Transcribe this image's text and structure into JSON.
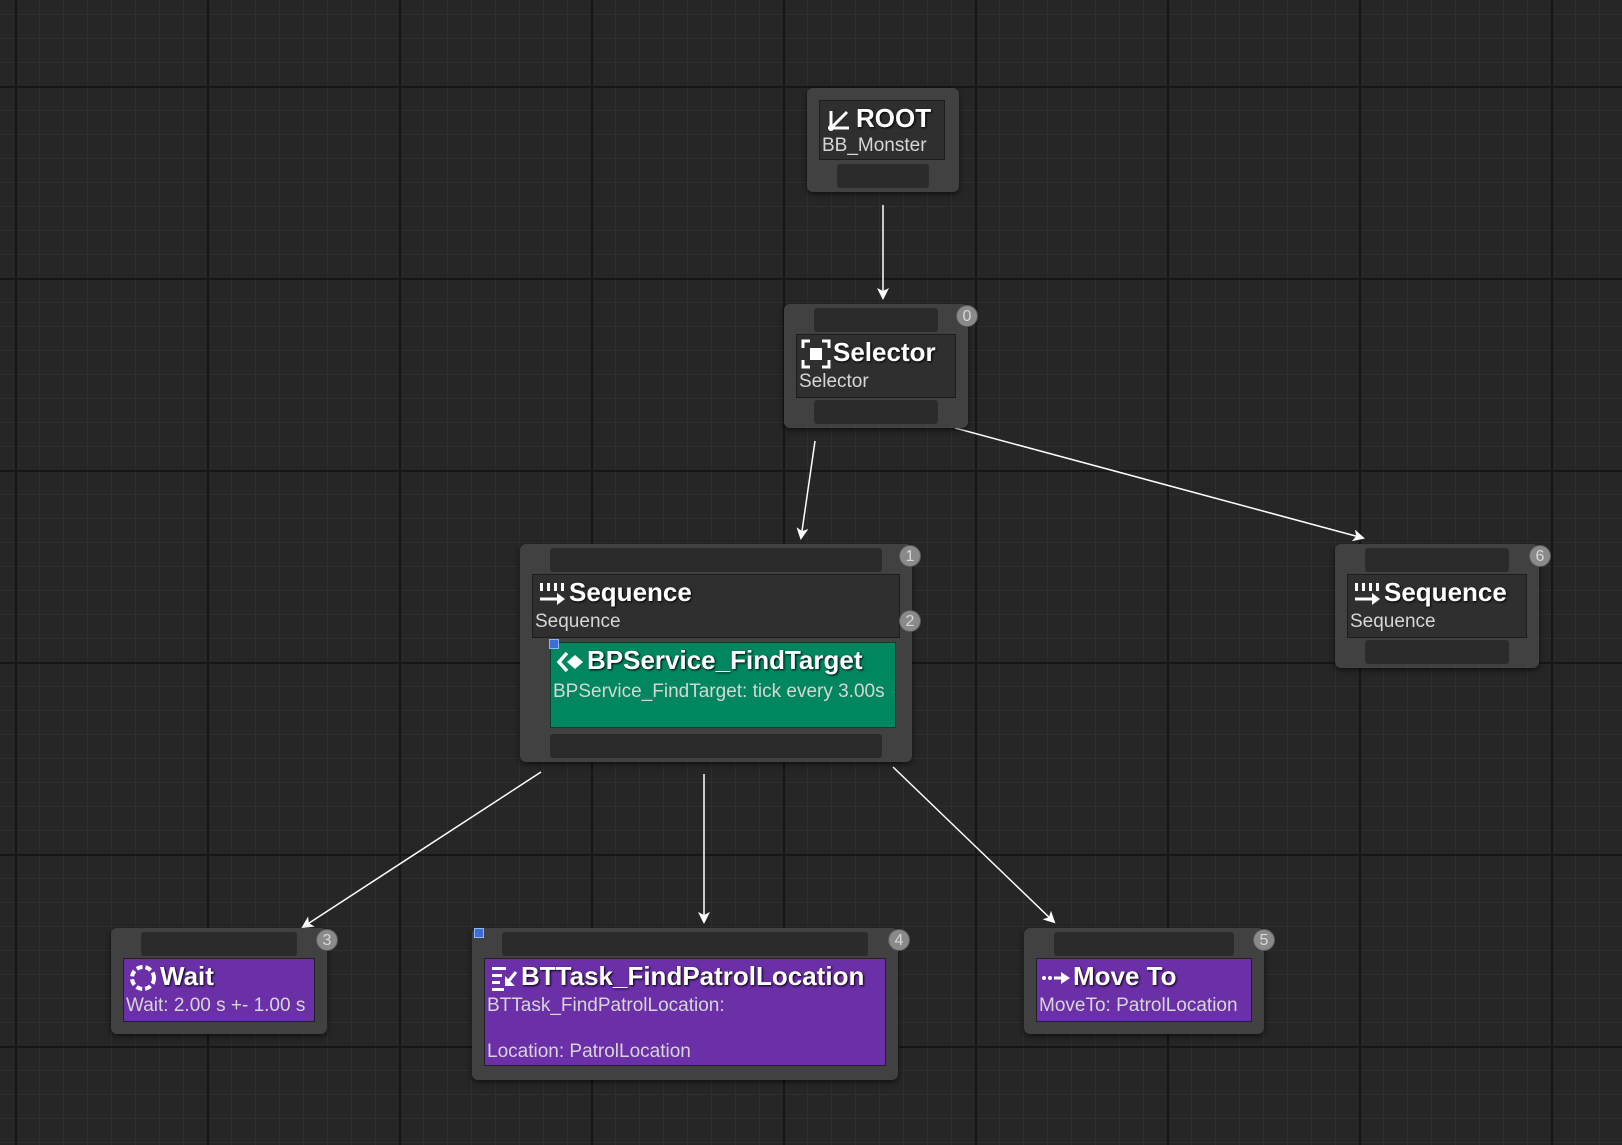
{
  "graph": {
    "root": {
      "title": "ROOT",
      "subtitle": "BB_Monster"
    },
    "selector": {
      "title": "Selector",
      "subtitle": "Selector",
      "index": "0"
    },
    "sequence_left": {
      "title": "Sequence",
      "subtitle": "Sequence",
      "index": "1",
      "service_index": "2"
    },
    "service": {
      "title": "BPService_FindTarget",
      "subtitle": "BPService_FindTarget: tick every 3.00s"
    },
    "sequence_right": {
      "title": "Sequence",
      "subtitle": "Sequence",
      "index": "6"
    },
    "wait": {
      "title": "Wait",
      "subtitle": "Wait: 2.00 s +- 1.00 s",
      "index": "3"
    },
    "find_patrol": {
      "title": "BTTask_FindPatrolLocation",
      "subtitle_line1": "BTTask_FindPatrolLocation:",
      "subtitle_line2": "Location: PatrolLocation",
      "index": "4"
    },
    "move_to": {
      "title": "Move To",
      "subtitle": "MoveTo: PatrolLocation",
      "index": "5"
    }
  },
  "colors": {
    "background": "#262626",
    "node": "#414141",
    "task": "#6b2fa8",
    "service": "#00875f",
    "wire": "#ffffff"
  },
  "icons": {
    "root": "root-branch-icon",
    "selector": "selector-icon",
    "sequence": "sequence-icon",
    "service": "service-icon",
    "wait": "wait-icon",
    "task": "task-icon",
    "move_to": "move-to-icon"
  }
}
